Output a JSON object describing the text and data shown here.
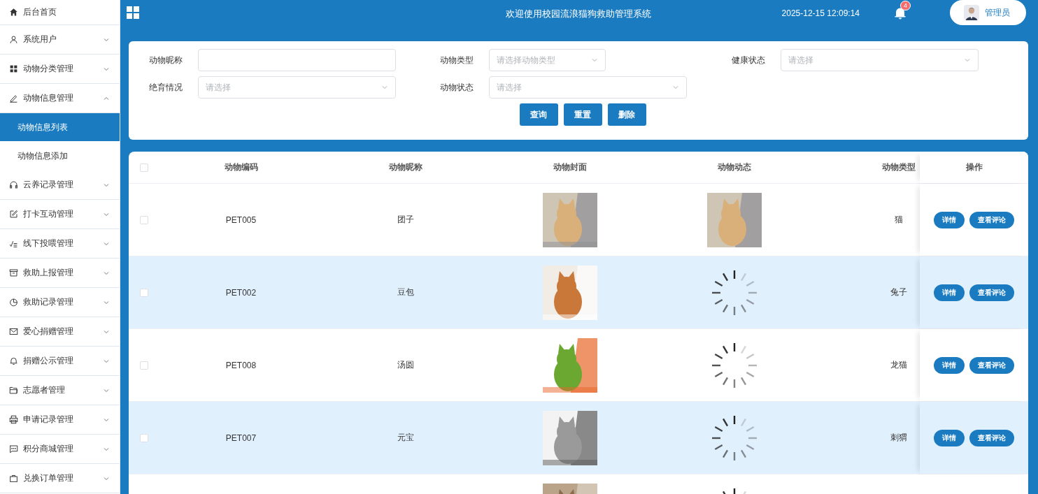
{
  "sidebar": {
    "items": [
      {
        "label": "后台首页"
      },
      {
        "label": "系统用户",
        "expanded": false
      },
      {
        "label": "动物分类管理",
        "expanded": false
      },
      {
        "label": "动物信息管理",
        "expanded": true,
        "children": [
          {
            "label": "动物信息列表",
            "selected": true
          },
          {
            "label": "动物信息添加",
            "selected": false
          }
        ]
      },
      {
        "label": "云养记录管理",
        "expanded": false
      },
      {
        "label": "打卡互动管理",
        "expanded": false
      },
      {
        "label": "线下投喂管理",
        "expanded": false
      },
      {
        "label": "救助上报管理",
        "expanded": false
      },
      {
        "label": "救助记录管理",
        "expanded": false
      },
      {
        "label": "爱心捐赠管理",
        "expanded": false
      },
      {
        "label": "捐赠公示管理",
        "expanded": false
      },
      {
        "label": "志愿者管理",
        "expanded": false
      },
      {
        "label": "申请记录管理",
        "expanded": false
      },
      {
        "label": "积分商城管理",
        "expanded": false
      },
      {
        "label": "兑换订单管理",
        "expanded": false
      }
    ]
  },
  "header": {
    "title": "欢迎使用校园流浪猫狗救助管理系统",
    "datetime": "2025-12-15 12:09:14",
    "notification_count": "4",
    "user": "管理员"
  },
  "search": {
    "fields": [
      {
        "label": "动物昵称",
        "kind": "input"
      },
      {
        "label": "动物类型",
        "kind": "select",
        "placeholder": "请选择动物类型"
      },
      {
        "label": "健康状态",
        "kind": "select",
        "placeholder": "请选择"
      },
      {
        "label": "绝育情况",
        "kind": "select",
        "placeholder": "请选择"
      },
      {
        "label": "动物状态",
        "kind": "select",
        "placeholder": "请选择"
      }
    ],
    "buttons": [
      "查询",
      "重置",
      "删除"
    ]
  },
  "table": {
    "all_checked": false,
    "columns": [
      "动物编码",
      "动物昵称",
      "动物封面",
      "动物动态",
      "动物类型",
      "操作"
    ],
    "rows": [
      {
        "checked": false,
        "code": "PET005",
        "name": "团子",
        "cover": {
          "kind": "picture"
        },
        "dynamic": {
          "kind": "picture"
        },
        "type": "猫",
        "actions": [
          "详情",
          "查看评论"
        ]
      },
      {
        "checked": false,
        "code": "PET002",
        "name": "豆包",
        "cover": {
          "kind": "picture"
        },
        "dynamic": {
          "kind": "loading"
        },
        "type": "兔子",
        "actions": [
          "详情",
          "查看评论"
        ]
      },
      {
        "checked": false,
        "code": "PET008",
        "name": "汤圆",
        "cover": {
          "kind": "picture"
        },
        "dynamic": {
          "kind": "loading"
        },
        "type": "龙猫",
        "actions": [
          "详情",
          "查看评论"
        ]
      },
      {
        "checked": false,
        "code": "PET007",
        "name": "元宝",
        "cover": {
          "kind": "picture"
        },
        "dynamic": {
          "kind": "loading"
        },
        "type": "刺猬",
        "actions": [
          "详情",
          "查看评论"
        ]
      },
      {
        "cover": {
          "kind": "picture"
        },
        "dynamic": {
          "kind": "loading"
        }
      }
    ]
  }
}
